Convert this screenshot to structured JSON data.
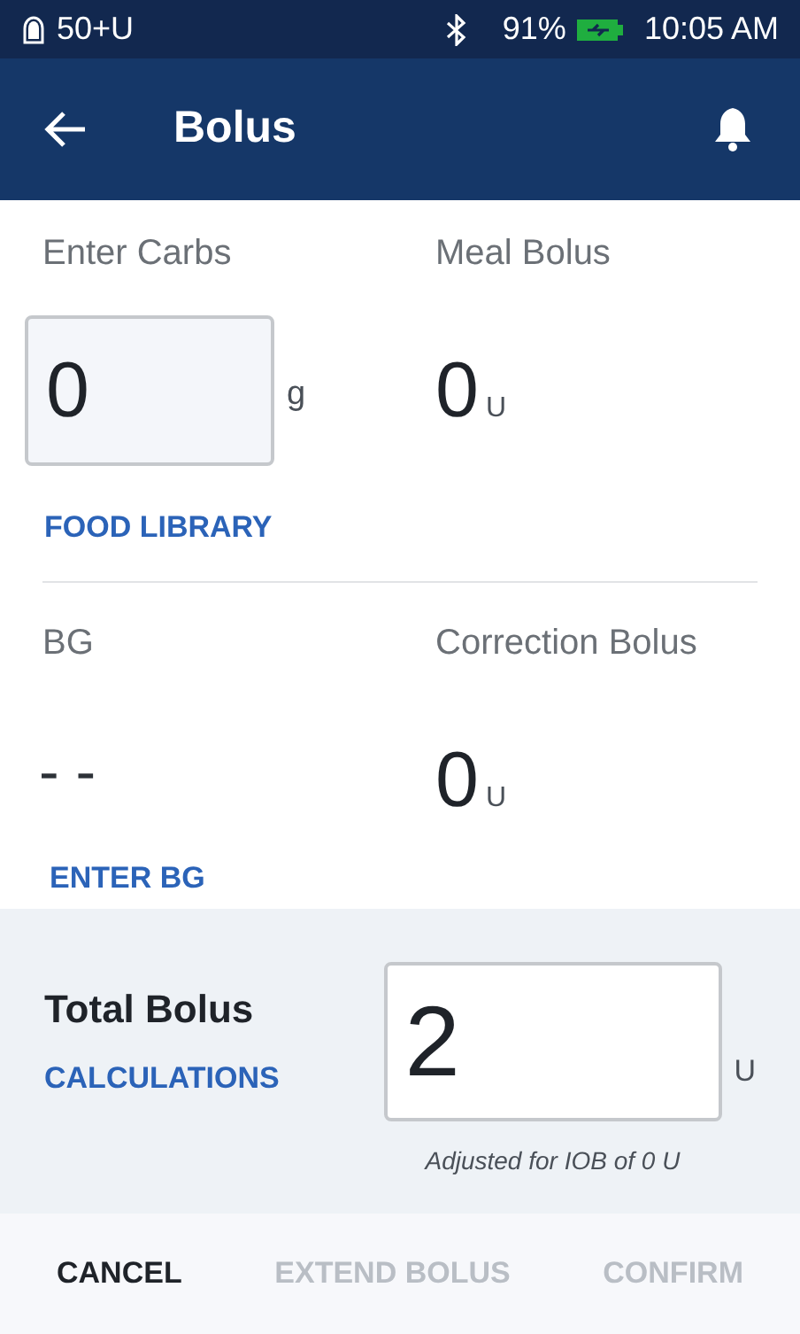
{
  "status_bar": {
    "insulin": "50+U",
    "battery": "91%",
    "time": "10:05 AM"
  },
  "header": {
    "title": "Bolus"
  },
  "carbs": {
    "label": "Enter Carbs",
    "value": "0",
    "unit": "g",
    "link": "FOOD LIBRARY"
  },
  "meal_bolus": {
    "label": "Meal Bolus",
    "value": "0",
    "unit": "U"
  },
  "bg": {
    "label": "BG",
    "value": "- -",
    "link": "ENTER BG"
  },
  "correction_bolus": {
    "label": "Correction Bolus",
    "value": "0",
    "unit": "U"
  },
  "total": {
    "label": "Total Bolus",
    "link": "CALCULATIONS",
    "value": "2",
    "unit": "U",
    "note": "Adjusted for IOB of 0 U"
  },
  "actions": [
    {
      "label": "CANCEL",
      "disabled": false
    },
    {
      "label": "EXTEND BOLUS",
      "disabled": true
    },
    {
      "label": "CONFIRM",
      "disabled": true
    }
  ]
}
